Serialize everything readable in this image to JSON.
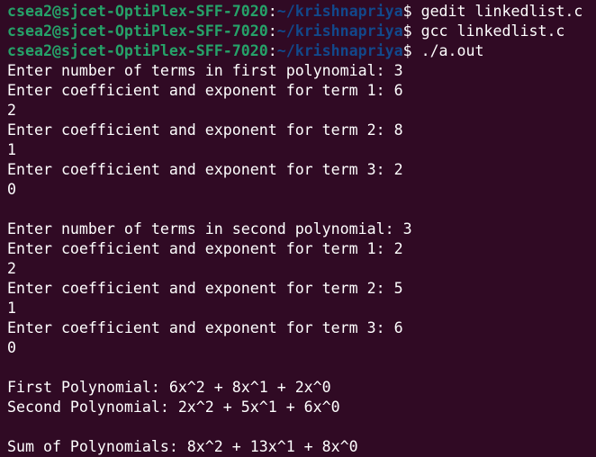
{
  "colors": {
    "background": "#300a24",
    "user_host": "#26a269",
    "path": "#12488b",
    "text": "#ffffff"
  },
  "prompts": [
    {
      "user_host": "csea2@sjcet-OptiPlex-SFF-7020",
      "sep": ":",
      "path": "~/krishnapriya",
      "dollar": "$ ",
      "command": "gedit linkedlist.c"
    },
    {
      "user_host": "csea2@sjcet-OptiPlex-SFF-7020",
      "sep": ":",
      "path": "~/krishnapriya",
      "dollar": "$ ",
      "command": "gcc linkedlist.c"
    },
    {
      "user_host": "csea2@sjcet-OptiPlex-SFF-7020",
      "sep": ":",
      "path": "~/krishnapriya",
      "dollar": "$ ",
      "command": "./a.out"
    }
  ],
  "output": [
    "Enter number of terms in first polynomial: 3",
    "Enter coefficient and exponent for term 1: 6",
    "2",
    "Enter coefficient and exponent for term 2: 8",
    "1",
    "Enter coefficient and exponent for term 3: 2",
    "0",
    "",
    "Enter number of terms in second polynomial: 3",
    "Enter coefficient and exponent for term 1: 2",
    "2",
    "Enter coefficient and exponent for term 2: 5",
    "1",
    "Enter coefficient and exponent for term 3: 6",
    "0",
    "",
    "First Polynomial: 6x^2 + 8x^1 + 2x^0",
    "Second Polynomial: 2x^2 + 5x^1 + 6x^0",
    "",
    "Sum of Polynomials: 8x^2 + 13x^1 + 8x^0"
  ]
}
